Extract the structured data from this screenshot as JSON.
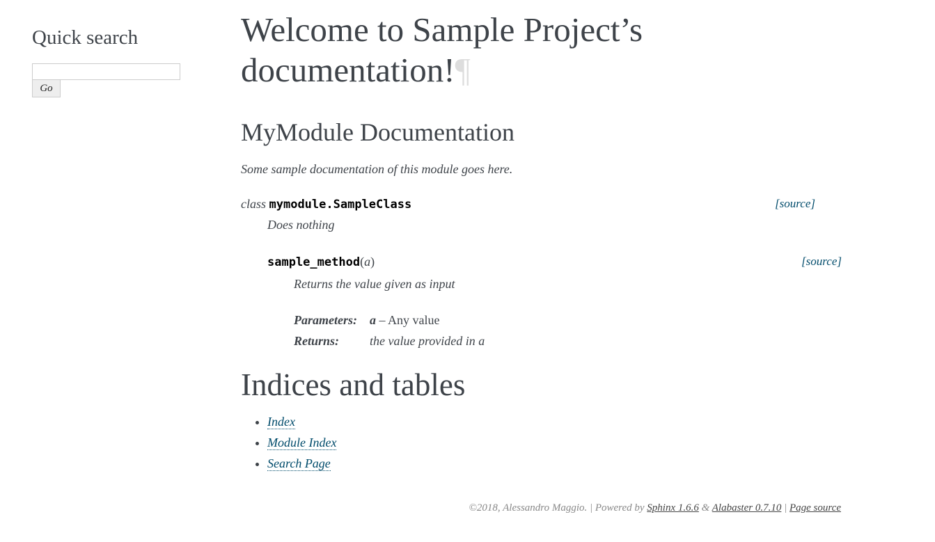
{
  "sidebar": {
    "heading": "Quick search",
    "search_value": "",
    "go_label": "Go"
  },
  "main": {
    "title": "Welcome to Sample Project’s documentation!",
    "title_anchor": "¶",
    "module_heading": "MyModule Documentation",
    "module_desc": "Some sample documentation of this module goes here.",
    "class_sig": {
      "keyword": "class",
      "name": "mymodule.SampleClass",
      "source_label": "[source]",
      "description": "Does nothing"
    },
    "method_sig": {
      "name": "sample_method",
      "open_paren": "(",
      "param": "a",
      "close_paren": ")",
      "source_label": "[source]",
      "description": "Returns the value given as input",
      "fields": {
        "parameters_label": "Parameters:",
        "parameter_name": "a",
        "parameter_desc": " – Any value",
        "returns_label": "Returns:",
        "returns_desc": "the value provided in a"
      }
    },
    "indices_heading": "Indices and tables",
    "links": [
      {
        "label": "Index"
      },
      {
        "label": "Module Index"
      },
      {
        "label": "Search Page"
      }
    ]
  },
  "footer": {
    "copyright": "©2018, Alessandro Maggio. | Powered by ",
    "sphinx_link": "Sphinx 1.6.6",
    "amp": " & ",
    "alabaster_link": "Alabaster 0.7.10",
    "sep": " | ",
    "source_link": "Page source"
  },
  "colors": {
    "text": "#3e4349",
    "link": "#004b6b",
    "pilcrow": "#dddddd"
  }
}
